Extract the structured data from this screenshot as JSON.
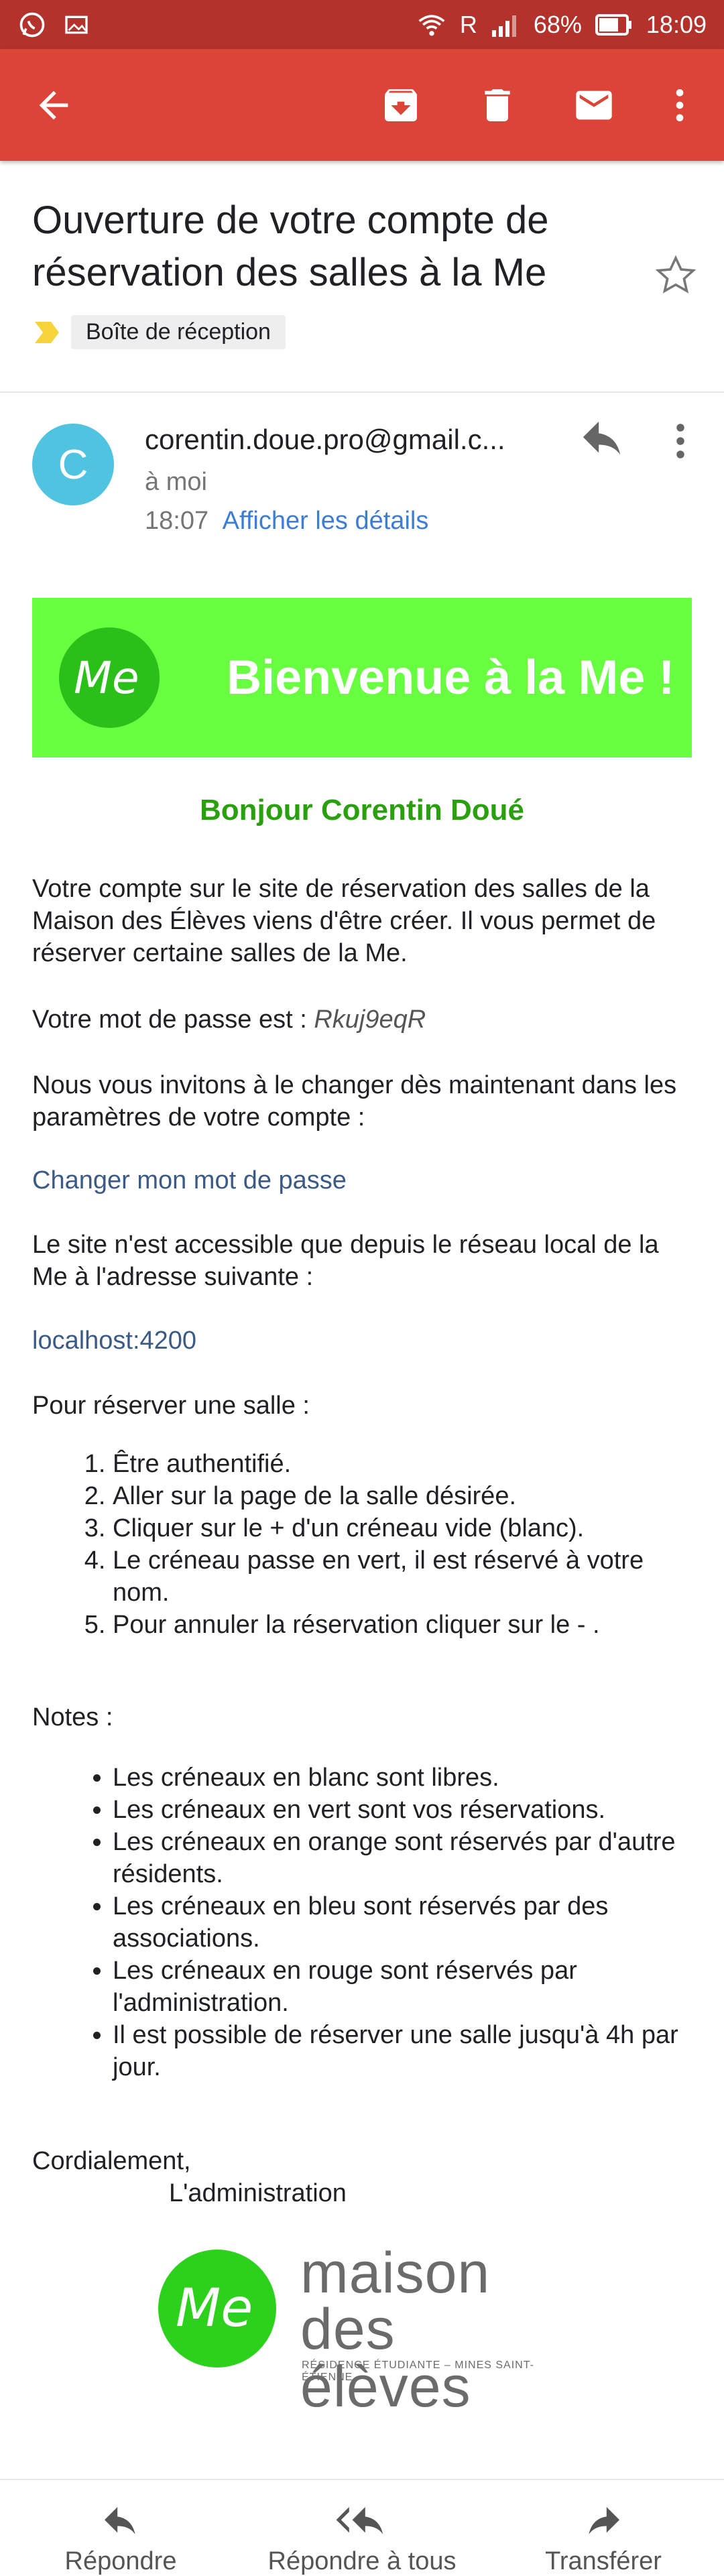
{
  "status_bar": {
    "carrier_indicator": "R",
    "battery": "68%",
    "time": "18:09",
    "icons": [
      "whatsapp-icon",
      "gallery-icon",
      "wifi-icon",
      "signal-icon",
      "battery-icon"
    ]
  },
  "toolbar": {
    "icons": [
      "back-arrow-icon",
      "archive-icon",
      "delete-icon",
      "mark-unread-icon",
      "more-vert-icon"
    ]
  },
  "email": {
    "subject": "Ouverture de votre compte de réservation des salles à la Me",
    "label": "Boîte de réception",
    "sender": {
      "initial": "C",
      "address": "corentin.doue.pro@gmail.c...",
      "recipient": "à moi",
      "time": "18:07",
      "details_link": "Afficher les détails"
    },
    "body": {
      "banner_logo_text": "Me",
      "banner_title": "Bienvenue à la Me !",
      "greeting": "Bonjour Corentin Doué",
      "intro": "Votre compte sur le site de réservation des salles de la Maison des Élèves viens d'être créer. Il vous permet de réserver certaine salles de la Me.",
      "password_label": "Votre mot de passe est : ",
      "password_value": "Rkuj9eqR",
      "change_invite": "Nous vous invitons à le changer dès maintenant dans les paramètres de votre compte :",
      "change_link": "Changer mon mot de passe",
      "access_info": "Le site n'est accessible que depuis le réseau local de la Me à l'adresse suivante :",
      "local_link": "localhost:4200",
      "reserve_title": "Pour réserver une salle :",
      "steps": [
        "Être authentifié.",
        "Aller sur la page de la salle désirée.",
        "Cliquer sur le + d'un créneau vide (blanc).",
        "Le créneau passe en vert, il est réservé à votre nom.",
        "Pour annuler la réservation cliquer sur le - ."
      ],
      "notes_title": "Notes :",
      "notes": [
        "Les créneaux en blanc sont libres.",
        "Les créneaux en vert sont vos réservations.",
        "Les créneaux en orange sont réservés par d'autre résidents.",
        "Les créneaux en bleu sont réservés par des associations.",
        "Les créneaux en rouge sont réservés par l'administration.",
        "Il est possible de réserver une salle jusqu'à 4h par jour."
      ],
      "signoff": "Cordialement,",
      "signature": "L'administration",
      "footer_logo": {
        "mark_text": "Me",
        "line1": "maison",
        "line2": "des élèves",
        "tagline": "RÉSIDENCE ÉTUDIANTE – MINES SAINT-ÉTIENNE"
      }
    }
  },
  "bottom_bar": {
    "reply": "Répondre",
    "reply_all": "Répondre à tous",
    "forward": "Transférer"
  },
  "colors": {
    "status_bar": "#b3322b",
    "app_bar": "#db4437",
    "avatar": "#4fc3e0",
    "banner": "#67ff3f",
    "greeting": "#2aa00f",
    "link": "#3b5b86",
    "details_link": "#3e7dd6"
  }
}
